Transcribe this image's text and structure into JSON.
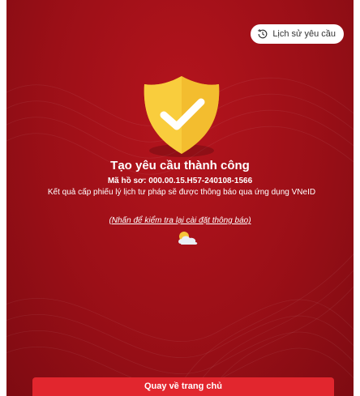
{
  "header": {
    "history_label": "Lịch sử yêu cầu",
    "history_icon": "history-clock-icon"
  },
  "result": {
    "icon": "shield-check-icon",
    "title": "Tạo yêu cầu thành công",
    "record_code": "Mã hồ sơ: 000.00.15.H57-240108-1566",
    "message": "Kết quả cấp phiếu lý lịch tư pháp sẽ được thông báo qua ứng dụng VNeID",
    "settings_link": "(Nhấn để kiểm tra lại cài đặt thông báo)",
    "status_icon": "weather-cloud-icon"
  },
  "footer": {
    "home_button": "Quay về trang chủ"
  },
  "colors": {
    "background": "#9b0f17",
    "accent": "#e2262e",
    "shield": "#f7c737"
  }
}
